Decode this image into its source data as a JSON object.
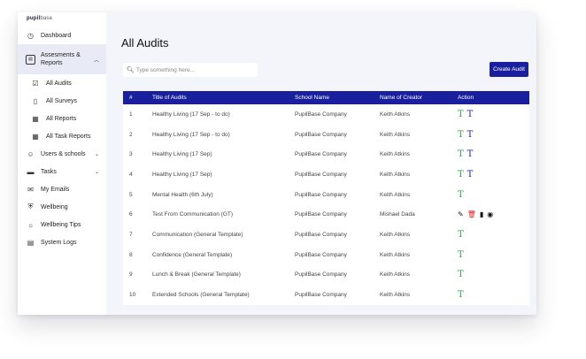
{
  "brand": {
    "part1": "pupil",
    "part2": "base"
  },
  "sidebar": {
    "items": [
      {
        "label": "Dashboard",
        "icon": "clock-icon"
      },
      {
        "label": "Assesments & Reports",
        "icon": "document-icon",
        "active": true
      },
      {
        "label": "Users & schools",
        "icon": "users-icon",
        "chevron": "⌄"
      },
      {
        "label": "Tasks",
        "icon": "tasks-icon",
        "chevron": "⌄"
      },
      {
        "label": "My Emails",
        "icon": "mail-icon"
      },
      {
        "label": "Wellbeing",
        "icon": "shield-icon"
      },
      {
        "label": "Wellbeing Tips",
        "icon": "bulb-icon"
      },
      {
        "label": "System Logs",
        "icon": "log-icon"
      }
    ],
    "sub_items": [
      {
        "label": "All Audits",
        "icon": "checklist-icon"
      },
      {
        "label": "All Surveys",
        "icon": "clipboard-icon"
      },
      {
        "label": "All Reports",
        "icon": "report-icon"
      },
      {
        "label": "All Task Reports",
        "icon": "report-icon"
      }
    ]
  },
  "page": {
    "title": "All Audits"
  },
  "search": {
    "placeholder": "Type something here..."
  },
  "toolbar": {
    "create_label": "Create Audit"
  },
  "table": {
    "headers": [
      "#",
      "Title of Audits",
      "School Name",
      "Name of Creator",
      "Action"
    ],
    "rows": [
      {
        "num": "1",
        "title": "Healthy Living (17 Sep - to do)",
        "school": "PupilBase Company",
        "creator": "Keith Atkins",
        "actions": [
          "T",
          "T"
        ]
      },
      {
        "num": "2",
        "title": "Healthy Living (17 Sep - to do)",
        "school": "PupilBase Company",
        "creator": "Keith Atkins",
        "actions": [
          "T",
          "T"
        ]
      },
      {
        "num": "3",
        "title": "Healthy Living (17 Sep)",
        "school": "PupilBase Company",
        "creator": "Keith Atkins",
        "actions": [
          "T",
          "T"
        ]
      },
      {
        "num": "4",
        "title": "Healthy Living (17 Sep)",
        "school": "PupilBase Company",
        "creator": "Keith Atkins",
        "actions": [
          "T",
          "T"
        ]
      },
      {
        "num": "5",
        "title": "Mental Health (6th July)",
        "school": "PupilBase Company",
        "creator": "Keith Atkins",
        "actions": [
          "T"
        ]
      },
      {
        "num": "6",
        "title": "Test From Communication (GT)",
        "school": "PupilBase Company",
        "creator": "Mishael Dada",
        "actions": [
          "edit",
          "delete",
          "copy",
          "view"
        ]
      },
      {
        "num": "7",
        "title": "Communication (General Template)",
        "school": "PupilBase Company",
        "creator": "Keith Atkins",
        "actions": [
          "T"
        ]
      },
      {
        "num": "8",
        "title": "Confidence (General Template)",
        "school": "PupilBase Company",
        "creator": "Keith Atkins",
        "actions": [
          "T"
        ]
      },
      {
        "num": "9",
        "title": "Lunch & Break (General Template)",
        "school": "PupilBase Company",
        "creator": "Keith Atkins",
        "actions": [
          "T"
        ]
      },
      {
        "num": "10",
        "title": "Extended Schools (General Template)",
        "school": "PupilBase Company",
        "creator": "Keith Atkins",
        "actions": [
          "T"
        ]
      }
    ]
  },
  "colors": {
    "primary": "#1a1f9e",
    "green": "#2e9e47",
    "danger": "#e02020",
    "bg": "#f4f5fa"
  }
}
